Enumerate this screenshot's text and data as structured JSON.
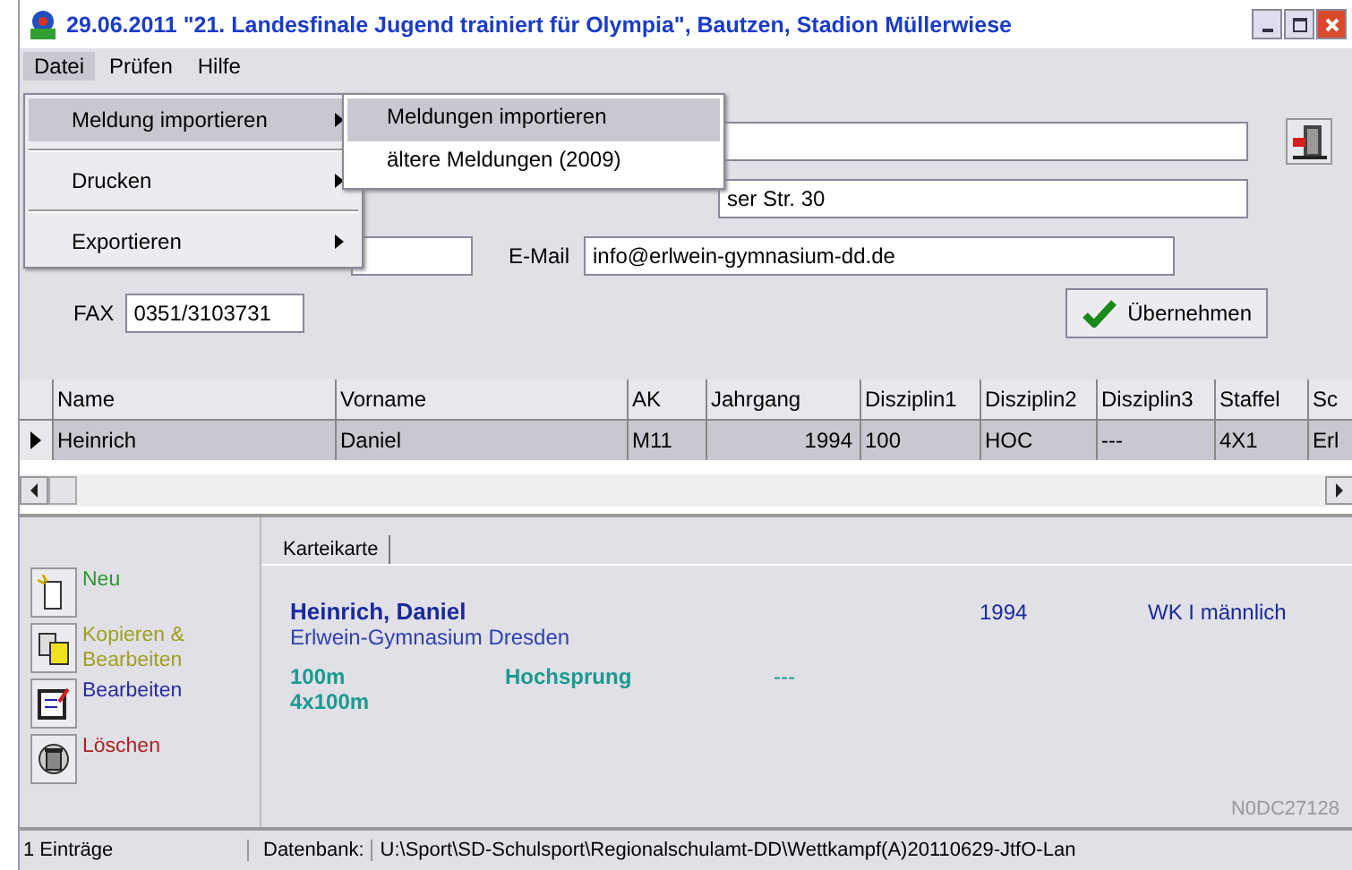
{
  "window": {
    "title": "29.06.2011 \"21. Landesfinale Jugend trainiert für Olympia\", Bautzen, Stadion Müllerwiese"
  },
  "menu_bar": [
    {
      "label": "Datei",
      "selected": true
    },
    {
      "label": "Prüfen",
      "selected": false
    },
    {
      "label": "Hilfe",
      "selected": false
    }
  ],
  "dropdown": [
    {
      "label": "Meldung importieren",
      "selected": true,
      "submenu": true
    },
    {
      "label": "Drucken",
      "selected": false,
      "submenu": true
    },
    {
      "label": "Exportieren",
      "selected": false,
      "submenu": true
    }
  ],
  "submenu": [
    {
      "label": "Meldungen importieren",
      "selected": true
    },
    {
      "label": "ältere Meldungen (2009)",
      "selected": false
    }
  ],
  "form": {
    "street_value": "ser Str. 30",
    "email_label": "E-Mail",
    "email_value": "info@erlwein-gymnasium-dd.de",
    "fax_label": "FAX",
    "fax_value": "0351/3103731",
    "apply_button": "Übernehmen"
  },
  "grid": {
    "columns": [
      "Name",
      "Vorname",
      "AK",
      "Jahrgang",
      "Disziplin1",
      "Disziplin2",
      "Disziplin3",
      "Staffel",
      "Sc"
    ],
    "rows": [
      {
        "selected": true,
        "cells": [
          "Heinrich",
          "Daniel",
          "M11",
          "1994",
          "100",
          "HOC",
          "---",
          "4X1",
          "Erl"
        ]
      }
    ]
  },
  "actions": [
    {
      "kind": "new",
      "label": "Neu",
      "color": "#2a9a2a"
    },
    {
      "kind": "copy",
      "label": "Kopieren & Bearbeiten",
      "color": "#a0a020"
    },
    {
      "kind": "edit",
      "label": "Bearbeiten",
      "color": "#2a2aa0"
    },
    {
      "kind": "delete",
      "label": "Löschen",
      "color": "#b02020"
    }
  ],
  "card": {
    "tab": "Karteikarte",
    "name": "Heinrich, Daniel",
    "school": "Erlwein-Gymnasium Dresden",
    "year": "1994",
    "class": "WK I männlich",
    "discipline_1": "100m",
    "discipline_2": "Hochsprung",
    "discipline_3": "---",
    "relay": "4x100m",
    "code": "N0DC27128"
  },
  "status_bar": {
    "count": "1 Einträge",
    "db_label": "Datenbank:",
    "db_path": "U:\\Sport\\SD-Schulsport\\Regionalschulamt-DD\\Wettkampf(A)20110629-JtfO-Lan"
  }
}
